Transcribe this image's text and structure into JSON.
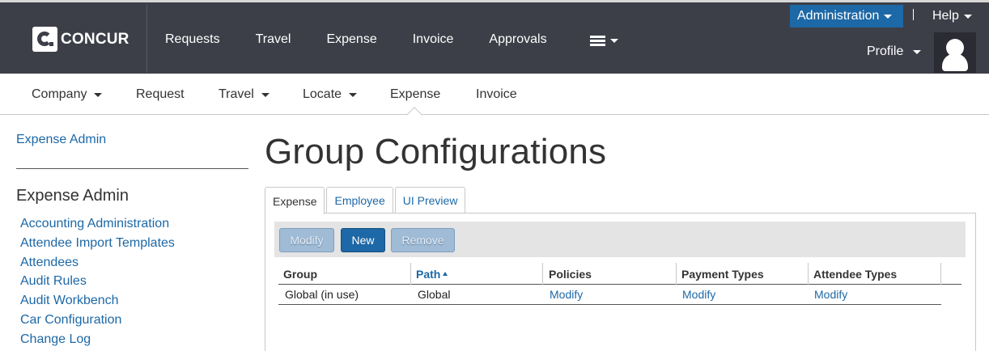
{
  "logo": {
    "text": "CONCUR"
  },
  "main_nav": [
    "Requests",
    "Travel",
    "Expense",
    "Invoice",
    "Approvals"
  ],
  "menu_icon": "hamburger-icon",
  "admin_menu": {
    "label": "Administration"
  },
  "help_menu": {
    "label": "Help"
  },
  "profile_menu": {
    "label": "Profile"
  },
  "sub_nav": [
    {
      "label": "Company",
      "dropdown": true
    },
    {
      "label": "Request",
      "dropdown": false
    },
    {
      "label": "Travel",
      "dropdown": true
    },
    {
      "label": "Locate",
      "dropdown": true
    },
    {
      "label": "Expense",
      "dropdown": false,
      "active": true
    },
    {
      "label": "Invoice",
      "dropdown": false
    }
  ],
  "sidebar": {
    "top_link": "Expense Admin",
    "heading": "Expense Admin",
    "items": [
      "Accounting Administration",
      "Attendee Import Templates",
      "Attendees",
      "Audit Rules",
      "Audit Workbench",
      "Car Configuration",
      "Change Log"
    ]
  },
  "page": {
    "title": "Group Configurations"
  },
  "tabs": [
    {
      "label": "Expense",
      "active": true
    },
    {
      "label": "Employee",
      "active": false
    },
    {
      "label": "UI Preview",
      "active": false
    }
  ],
  "toolbar": {
    "modify_label": "Modify",
    "new_label": "New",
    "remove_label": "Remove"
  },
  "grid": {
    "columns": [
      "Group",
      "Path",
      "Policies",
      "Payment Types",
      "Attendee Types"
    ],
    "sorted_column": "Path",
    "sort_direction": "ascending",
    "rows": [
      {
        "group": "Global (in use)",
        "path": "Global",
        "policies": "Modify",
        "payment_types": "Modify",
        "attendee_types": "Modify"
      }
    ]
  },
  "colors": {
    "header_bg": "#3d3f48",
    "accent": "#1d68a6",
    "link": "#1d68a6",
    "toolbar_bg": "#e4e4e4"
  }
}
